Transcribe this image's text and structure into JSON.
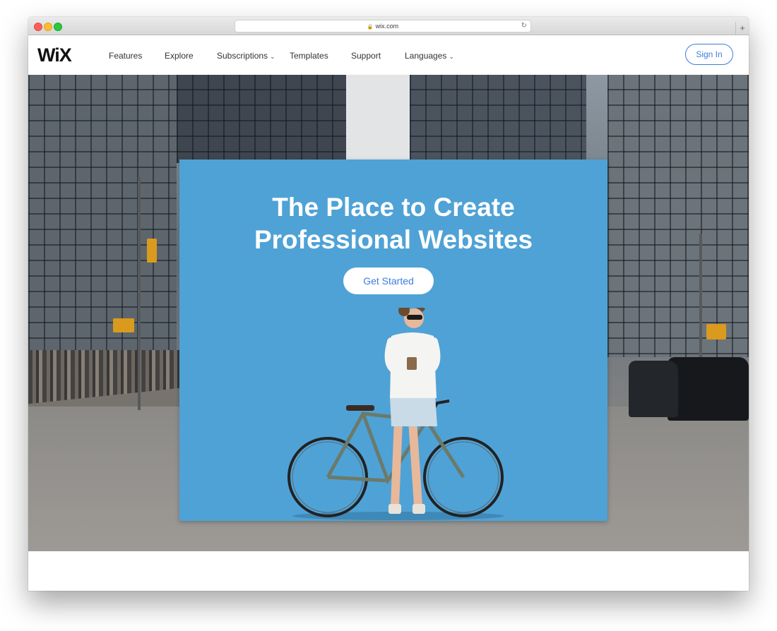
{
  "browser": {
    "url": "wix.com",
    "new_tab_symbol": "+"
  },
  "nav": {
    "logo": "WiX",
    "items": [
      {
        "label": "Features",
        "has_dropdown": false
      },
      {
        "label": "Explore",
        "has_dropdown": false
      },
      {
        "label": "Subscriptions",
        "has_dropdown": true
      },
      {
        "label": "Templates",
        "has_dropdown": false
      },
      {
        "label": "Support",
        "has_dropdown": false
      },
      {
        "label": "Languages",
        "has_dropdown": true
      }
    ],
    "sign_in": "Sign In"
  },
  "hero": {
    "title_line1": "The Place to Create",
    "title_line2": "Professional Websites",
    "cta": "Get Started"
  },
  "colors": {
    "accent": "#3b7ddd",
    "panel": "#4fa2d6"
  }
}
